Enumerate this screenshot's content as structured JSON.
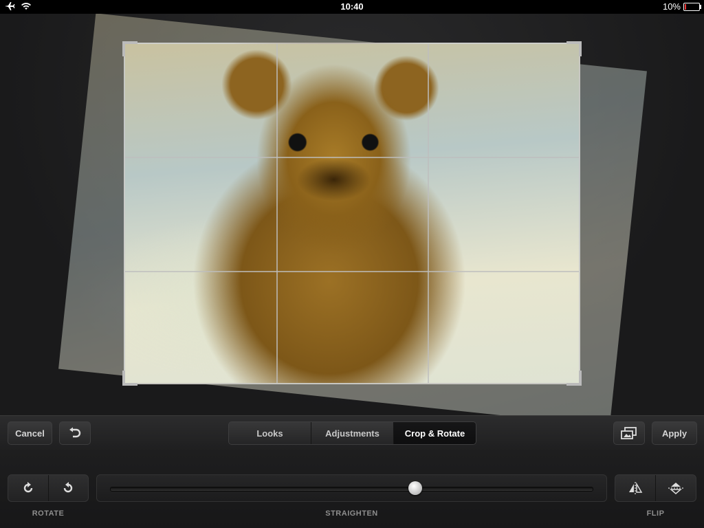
{
  "status_bar": {
    "time": "10:40",
    "battery_percent_label": "10%",
    "battery_level": 0.1,
    "icons": [
      "airplane-icon",
      "wifi-icon",
      "battery-icon"
    ]
  },
  "toolbar": {
    "cancel_label": "Cancel",
    "apply_label": "Apply",
    "tabs": [
      {
        "label": "Looks",
        "active": false
      },
      {
        "label": "Adjustments",
        "active": false
      },
      {
        "label": "Crop & Rotate",
        "active": true
      }
    ],
    "icons": [
      "undo-icon",
      "compare-icon"
    ]
  },
  "controls": {
    "rotate_label": "ROTATE",
    "straighten_label": "STRAIGHTEN",
    "flip_label": "FLIP",
    "straighten_value": 0.63,
    "icons": [
      "rotate-clockwise-icon",
      "rotate-counterclockwise-icon",
      "flip-horizontal-icon",
      "flip-vertical-icon"
    ]
  },
  "colors": {
    "background": "#1b1b1c",
    "active_tab": "#0e0e0f"
  }
}
